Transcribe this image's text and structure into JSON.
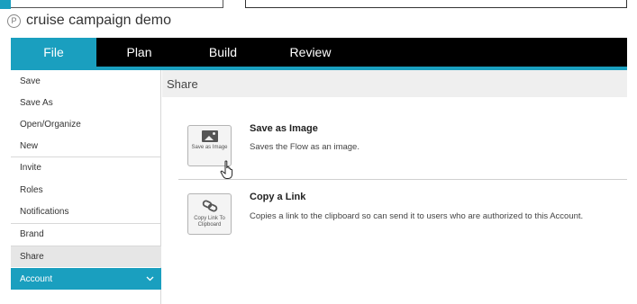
{
  "app": {
    "title": "cruise campaign demo",
    "title_icon": "P"
  },
  "nav": {
    "tabs": [
      {
        "label": "File",
        "active": true
      },
      {
        "label": "Plan",
        "active": false
      },
      {
        "label": "Build",
        "active": false
      },
      {
        "label": "Review",
        "active": false
      }
    ]
  },
  "sidebar": {
    "items": [
      {
        "label": "Save"
      },
      {
        "label": "Save As"
      },
      {
        "label": "Open/Organize"
      },
      {
        "label": "New"
      },
      {
        "label": "Invite"
      },
      {
        "label": "Roles"
      },
      {
        "label": "Notifications"
      },
      {
        "label": "Brand"
      },
      {
        "label": "Share",
        "selected": true
      },
      {
        "label": "Account",
        "expandable": true
      }
    ]
  },
  "main": {
    "header": "Share",
    "actions": [
      {
        "button_caption": "Save as Image",
        "title": "Save as Image",
        "description": "Saves the Flow as an image.",
        "icon": "image-icon"
      },
      {
        "button_caption": "Copy Link To Clipboard",
        "title": "Copy a Link",
        "description": "Copies a link to the clipboard so can send it to users who are authorized to this Account.",
        "icon": "link-icon"
      }
    ]
  },
  "colors": {
    "accent": "#1a9fbf",
    "navbar": "#000000",
    "header_bg": "#efefef",
    "selected_bg": "#e6e6e6"
  }
}
